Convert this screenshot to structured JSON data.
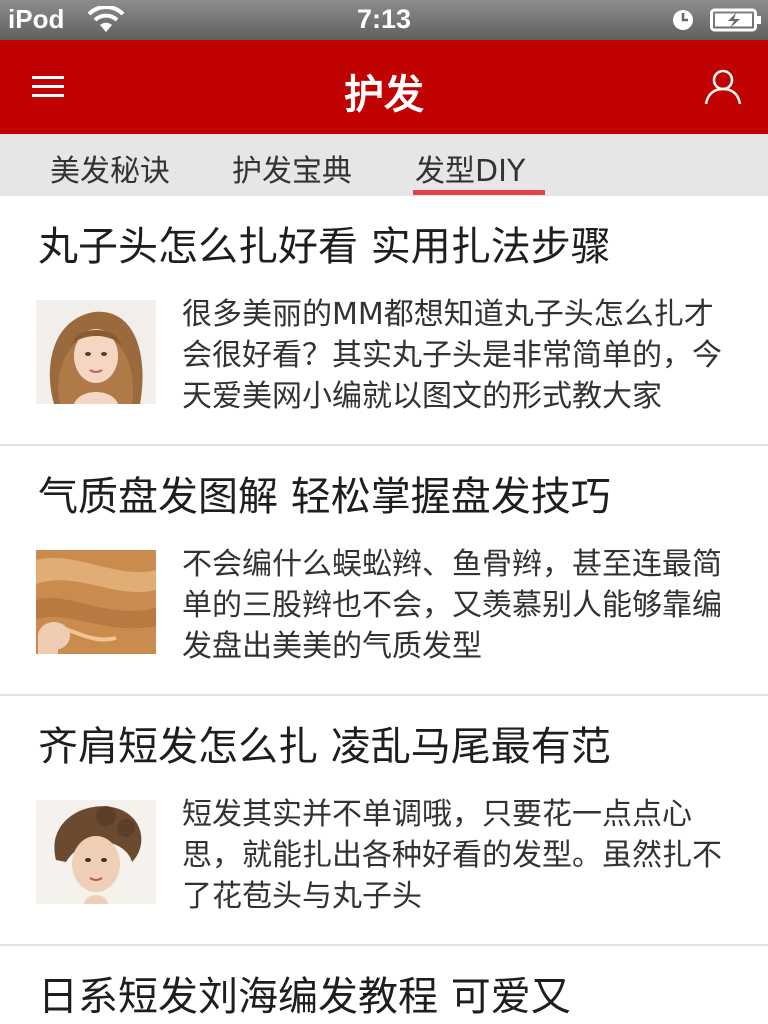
{
  "status_bar": {
    "carrier": "iPod",
    "time": "7:13"
  },
  "nav": {
    "title": "护发",
    "menu_icon": "hamburger-menu-icon",
    "user_icon": "user-icon",
    "bg_color": "#c10202"
  },
  "tabs": [
    {
      "label": "美发秘诀"
    },
    {
      "label": "护发宝典"
    },
    {
      "label": "发型DIY",
      "active": true
    }
  ],
  "articles": [
    {
      "title": "丸子头怎么扎好看 实用扎法步骤",
      "description": "很多美丽的MM都想知道丸子头怎么扎才会很好看？其实丸子头是非常简单的，今天爱美网小编就以图文的形式教大家",
      "thumbnail": "woman-portrait-photo"
    },
    {
      "title": "气质盘发图解 轻松掌握盘发技巧",
      "description": "不会编什么蜈蚣辫、鱼骨辫，甚至连最简单的三股辫也不会，又羡慕别人能够靠编发盘出美美的气质发型",
      "thumbnail": "hair-braiding-photo"
    },
    {
      "title": "齐肩短发怎么扎 凌乱马尾最有范",
      "description": "短发其实并不单调哦，只要花一点点心思，就能扎出各种好看的发型。虽然扎不了花苞头与丸子头",
      "thumbnail": "updo-hairstyle-photo"
    },
    {
      "title": "日系短发刘海编发教程 可爱又",
      "description": "",
      "thumbnail": ""
    }
  ]
}
